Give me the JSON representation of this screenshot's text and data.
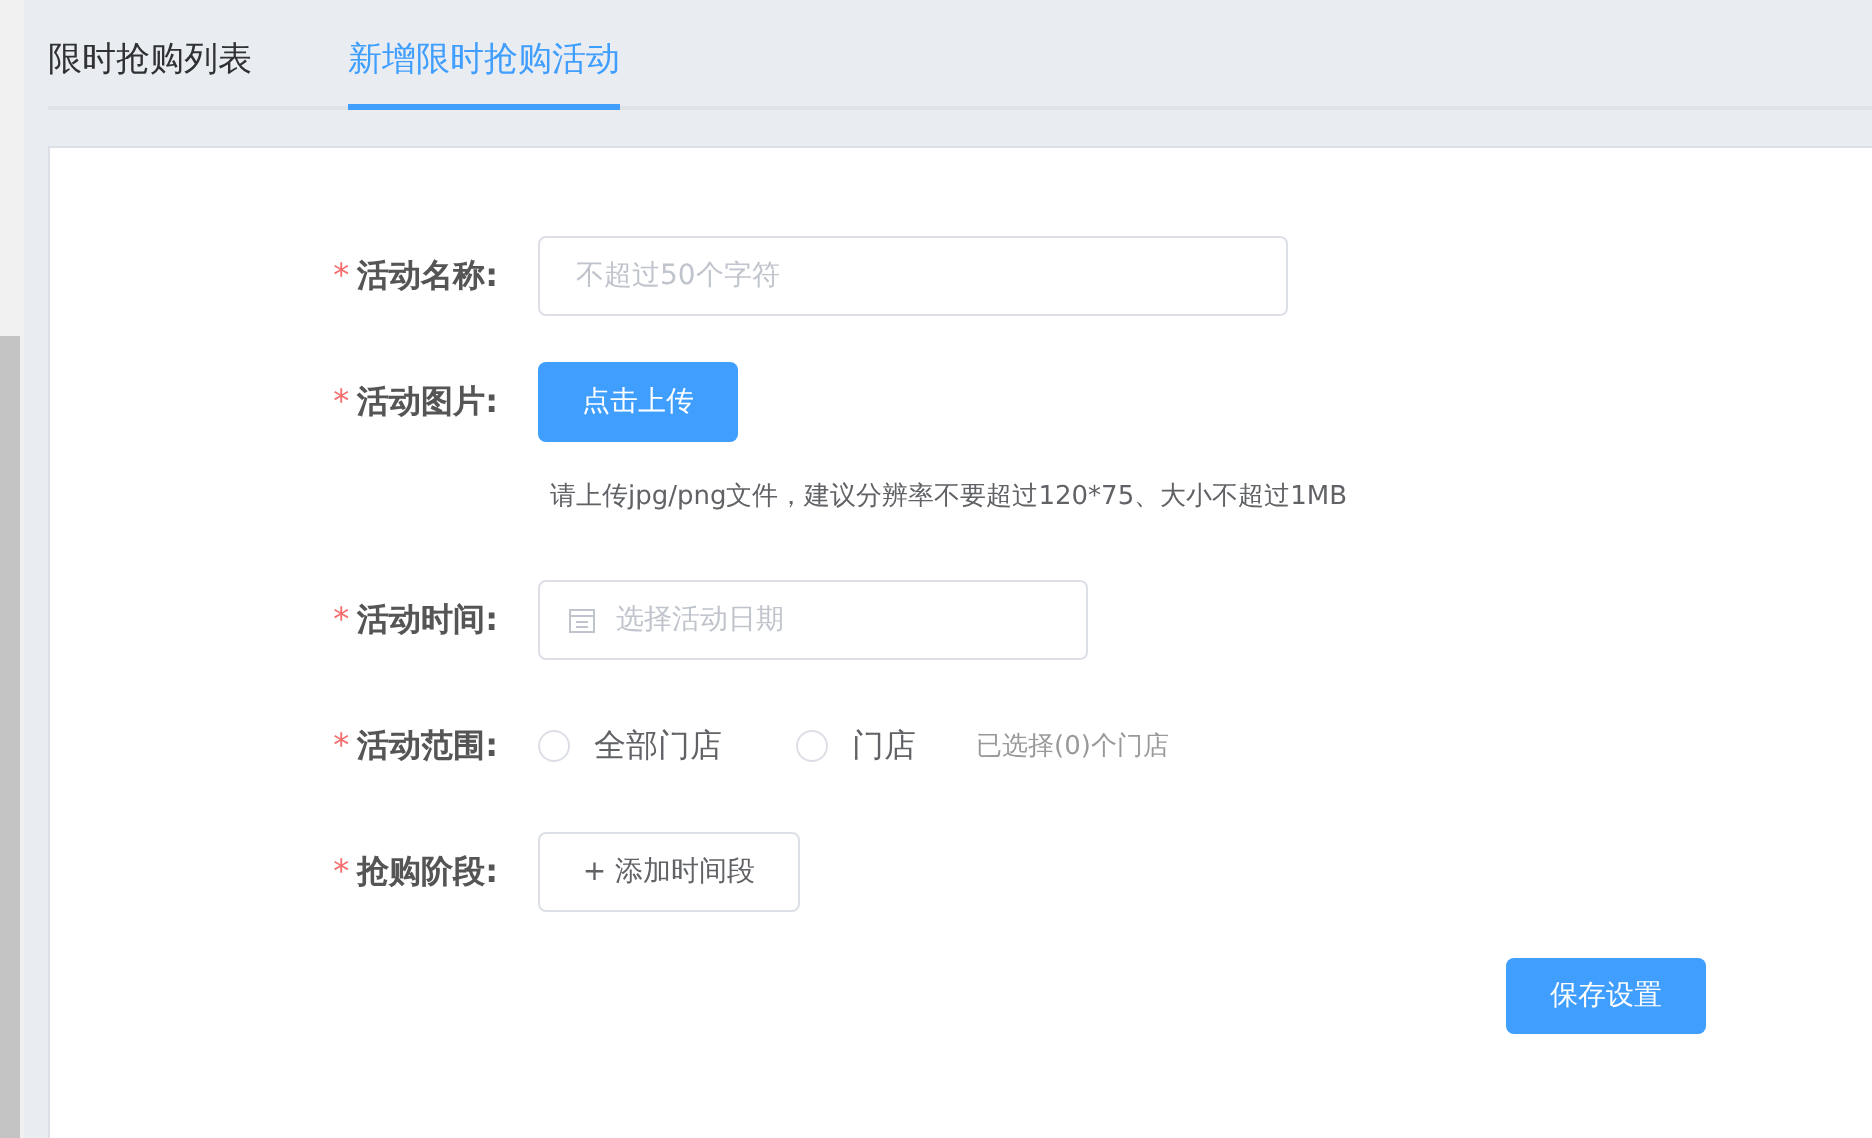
{
  "tabs": [
    {
      "label": "限时抢购列表",
      "selected": false
    },
    {
      "label": "新增限时抢购活动",
      "selected": true
    }
  ],
  "form": {
    "fields": [
      {
        "kind": "text",
        "label": "活动名称:",
        "required": true,
        "placeholder": "不超过50个字符"
      },
      {
        "kind": "upload",
        "label": "活动图片:",
        "required": true,
        "button": "点击上传",
        "hint": "请上传jpg/png文件，建议分辨率不要超过120*75、大小不超过1MB"
      },
      {
        "kind": "date",
        "label": "活动时间:",
        "required": true,
        "placeholder": "选择活动日期"
      },
      {
        "kind": "radio",
        "label": "活动范围:",
        "required": true,
        "options": [
          {
            "label": "全部门店",
            "selected": false
          },
          {
            "label": "门店",
            "selected": false
          }
        ],
        "note": "已选择(0)个门店"
      },
      {
        "kind": "add",
        "label": "抢购阶段:",
        "required": true,
        "button": "+ 添加时间段"
      }
    ],
    "required_mark": "*",
    "submit": "保存设置"
  }
}
